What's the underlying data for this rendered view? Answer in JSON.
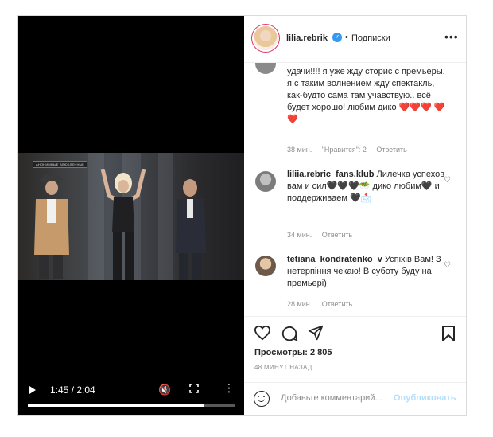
{
  "header": {
    "username": "lilia.rebrik",
    "verified_mark": "✓",
    "separator": "•",
    "follow_label": "Подписки",
    "more_label": "•••"
  },
  "video": {
    "badge_text": "АНОНИМНЫЕ ВЛЮБЛЕННЫЕ",
    "time": "1:45 / 2:04",
    "progress": 0.85,
    "muted_icon": "🔇",
    "more_label": "⋮"
  },
  "comments": [
    {
      "avatar": "user-avatar",
      "text": "удачи!!!! я уже жду сторис с премьеры. я с таким волнением жду спектакль, как-будто сама там учавствую.. всё будет хорошо! любим дико ❤️❤️❤️ ❤️❤️",
      "time": "38 мин.",
      "likes": "\"Нравится\": 2",
      "reply": "Ответить"
    },
    {
      "username": "liliia.rebric_fans.klub",
      "text": "Лилечка успехов вам и сил🖤🖤🖤🥗 дико любим🖤 и поддерживаем 🖤📩",
      "time": "34 мин.",
      "reply": "Ответить"
    },
    {
      "username": "tetiana_kondratenko_v",
      "text": "Успіхів Вам! З нетерпіння чекаю! В суботу буду на премьері)",
      "time": "28 мин.",
      "reply": "Ответить"
    }
  ],
  "actions": {
    "views": "Просмотры: 2 805",
    "time_ago": "48 МИНУТ НАЗАД"
  },
  "add_comment": {
    "placeholder": "Добавьте комментарий...",
    "publish": "Опубликовать"
  }
}
